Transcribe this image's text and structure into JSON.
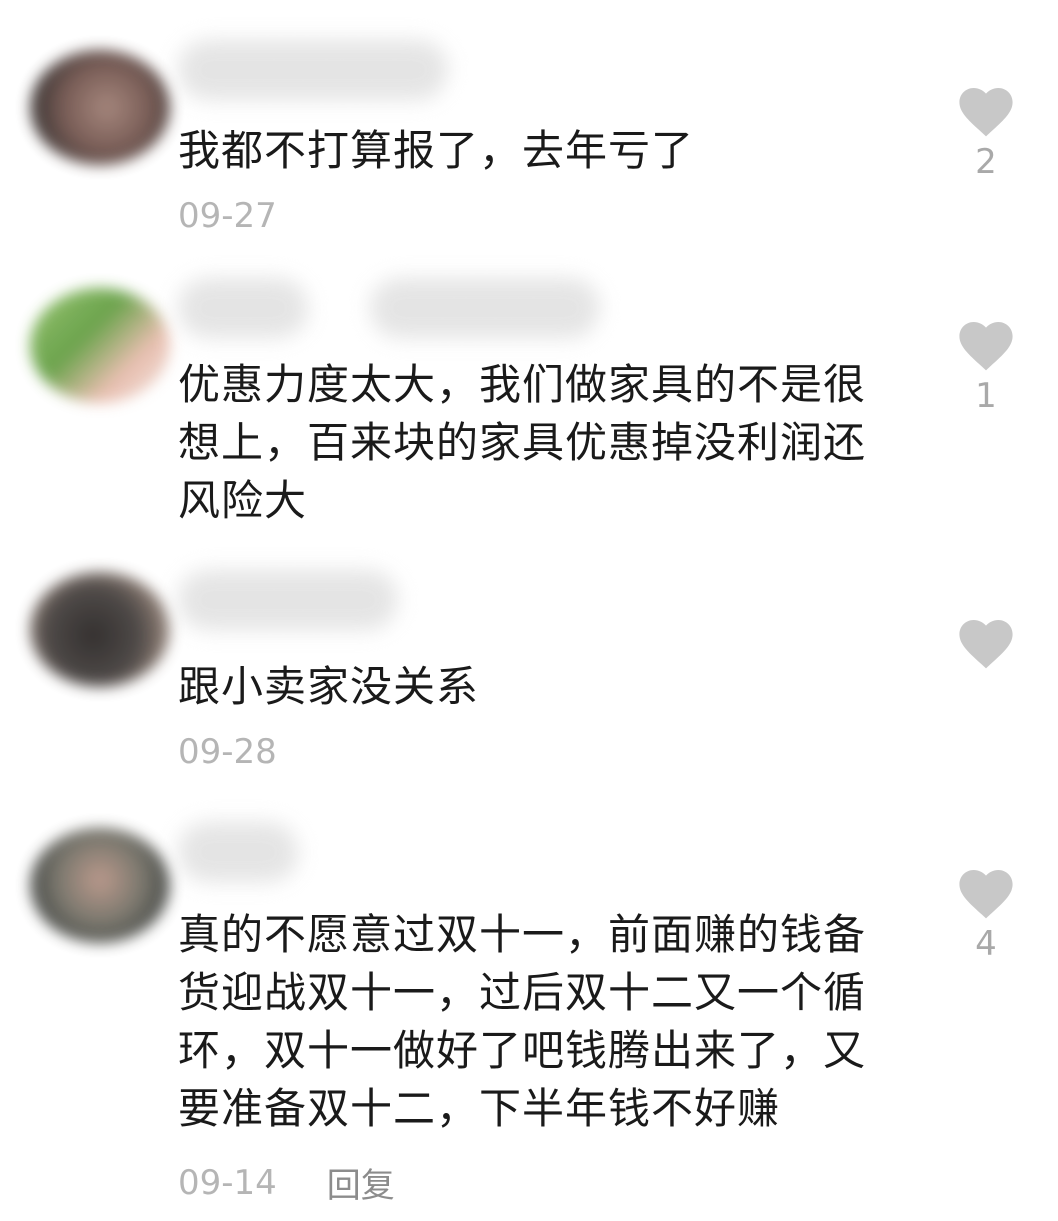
{
  "comments": [
    {
      "text": "我都不打算报了，去年亏了",
      "date": "09-27",
      "likes": "2",
      "avatar_color": "#8a6a5e"
    },
    {
      "text": "优惠力度太大，我们做家具的不是很想上，百来块的家具优惠掉没利润还风险大",
      "likes": "1",
      "avatar_color": "#7fae5a"
    },
    {
      "text": "跟小卖家没关系",
      "date": "09-28",
      "avatar_color": "#3b3634"
    },
    {
      "text": "真的不愿意过双十一，前面赚的钱备货迎战双十一，过后双十二又一个循环，双十一做好了吧钱腾出来了，又要准备双十二，下半年钱不好赚",
      "date": "09-14",
      "reply_label": "回复",
      "likes": "4",
      "avatar_color": "#6d6a5f"
    }
  ],
  "icons": {
    "like": "heart-icon",
    "heart_color": "#c8c8c8"
  }
}
